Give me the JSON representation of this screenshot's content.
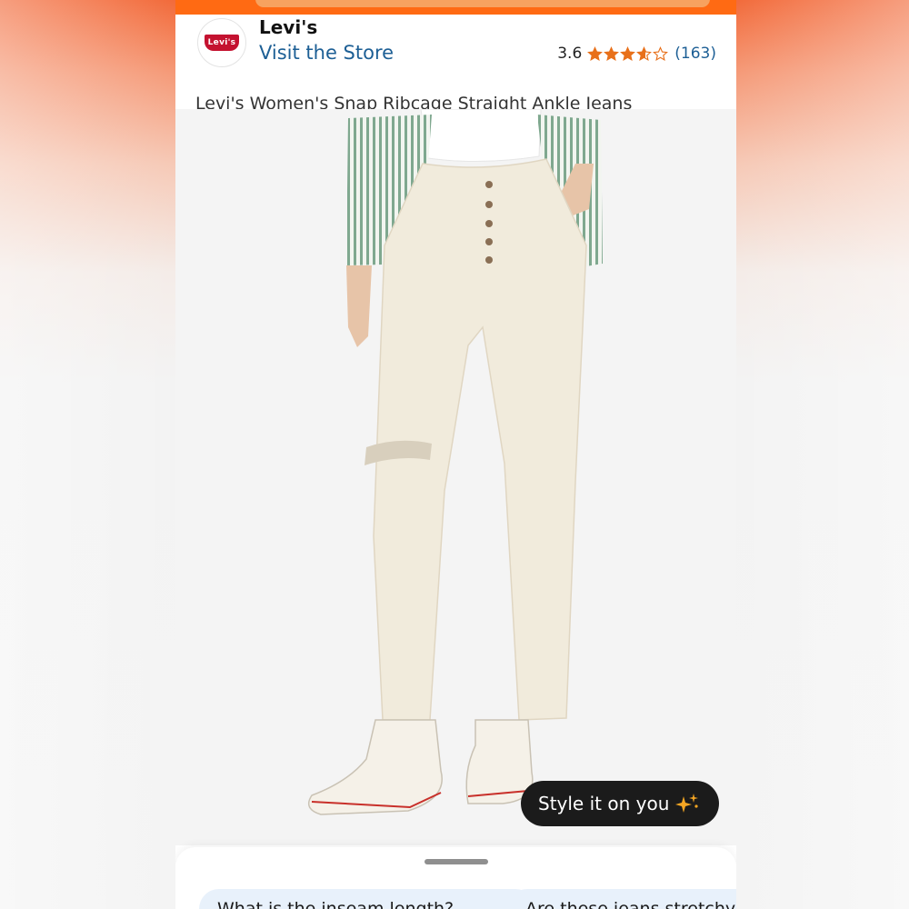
{
  "store": {
    "logo_text": "Levi's",
    "brand_name": "Levi's",
    "store_link": "Visit the Store",
    "rating": "3.6",
    "rating_value": 3.6,
    "rating_max": 5,
    "rating_count": "(163)"
  },
  "product": {
    "title": "Levi's Women's Snap Ribcage Straight Ankle Jeans",
    "image_icon": "product-photo-jeans"
  },
  "actions": {
    "style_button_label": "Style it on you",
    "style_button_icon": "sparkle-icon"
  },
  "suggestions": [
    {
      "label": "What is the inseam length?"
    },
    {
      "label": "Are these jeans stretchy?"
    }
  ],
  "colors": {
    "accent_orange": "#ff6a13",
    "link_blue": "#1d5f95",
    "star_orange": "#e8701a",
    "brand_red": "#c41230",
    "chip_bg": "#e8f1fb"
  }
}
